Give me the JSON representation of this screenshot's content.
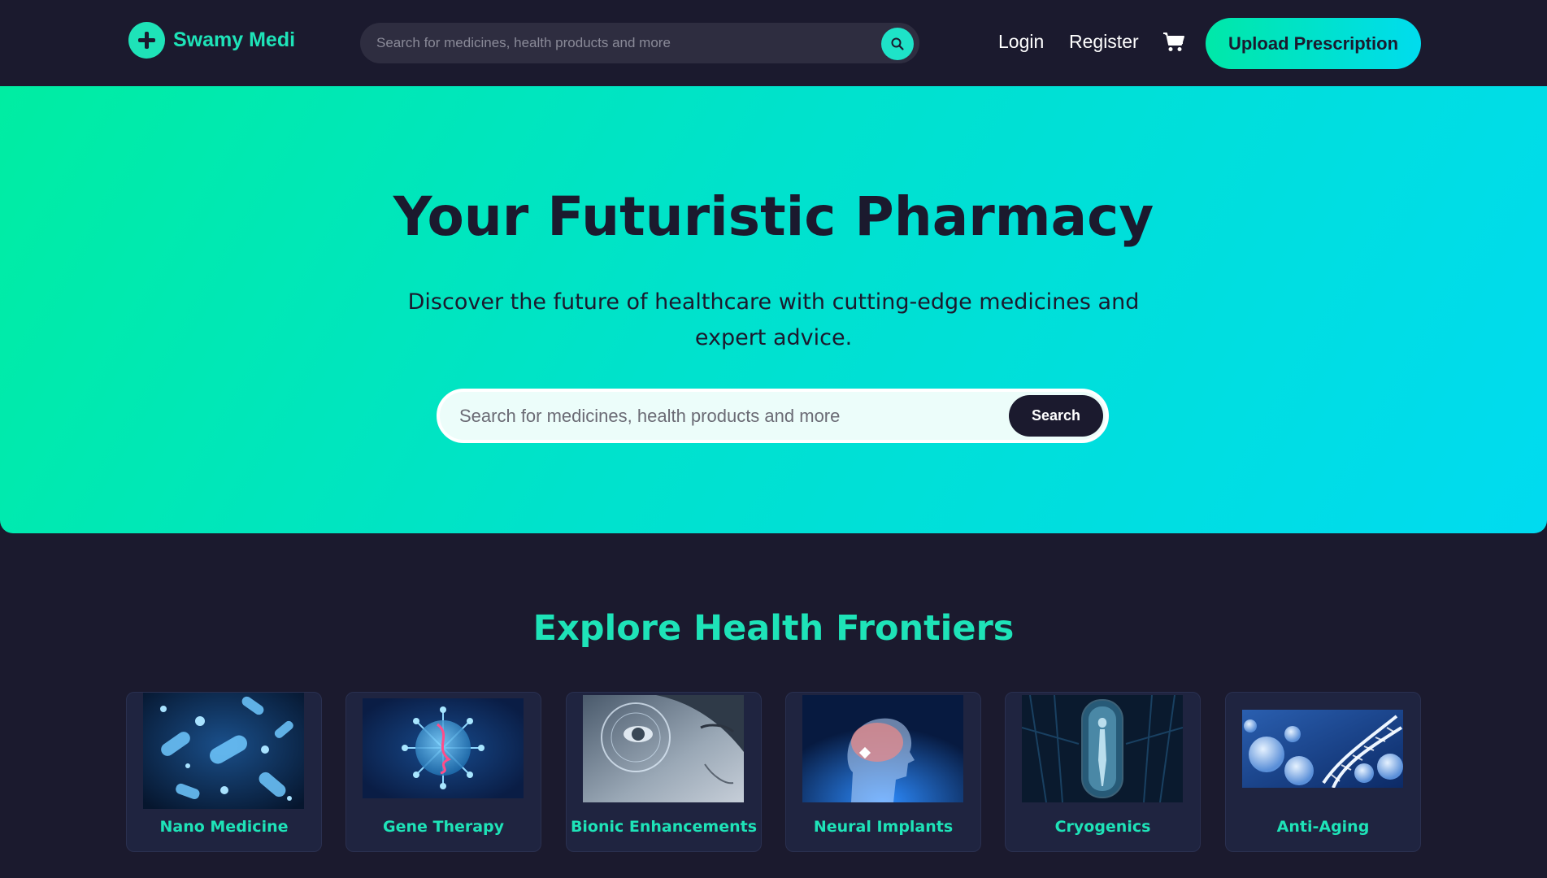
{
  "header": {
    "brand": "Swamy Medi",
    "search_placeholder": "Search for medicines, health products and more",
    "login_label": "Login",
    "register_label": "Register",
    "upload_label": "Upload Prescription"
  },
  "hero": {
    "title": "Your Futuristic Pharmacy",
    "subtitle_line1": "Discover the future of healthcare with cutting-edge medicines and",
    "subtitle_line2": "expert advice.",
    "search_placeholder": "Search for medicines, health products and more",
    "search_button": "Search"
  },
  "explore": {
    "title": "Explore Health Frontiers",
    "categories": [
      {
        "label": "Nano Medicine",
        "image": "nano-medicine-image"
      },
      {
        "label": "Gene Therapy",
        "image": "gene-therapy-image"
      },
      {
        "label": "Bionic Enhancements",
        "image": "bionic-eye-image"
      },
      {
        "label": "Neural Implants",
        "image": "neural-implant-image"
      },
      {
        "label": "Cryogenics",
        "image": "cryogenic-pod-image"
      },
      {
        "label": "Anti-Aging",
        "image": "dna-cells-image"
      }
    ]
  },
  "colors": {
    "background": "#1b1a2e",
    "accent": "#1ee3b8",
    "hero_gradient_start": "#00eda2",
    "hero_gradient_end": "#00dbf0"
  }
}
